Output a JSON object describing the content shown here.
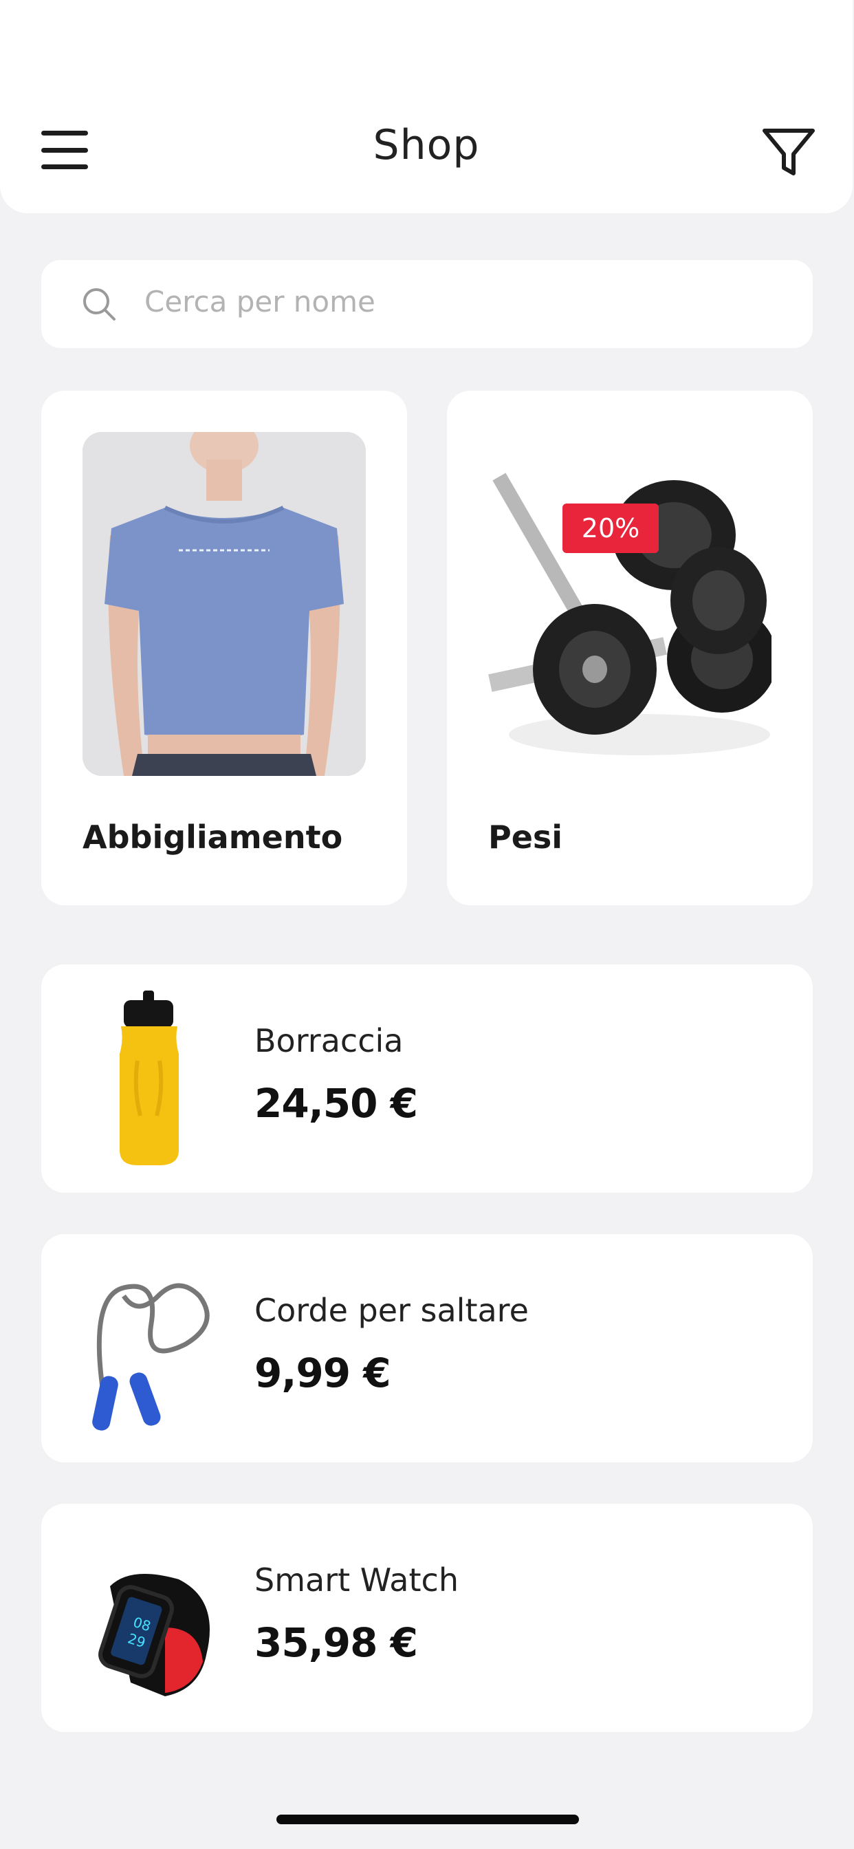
{
  "header": {
    "title": "Shop",
    "menu_icon": "hamburger-menu-icon",
    "filter_icon": "filter-funnel-icon"
  },
  "search": {
    "placeholder": "Cerca per nome",
    "icon": "search-icon"
  },
  "categories": [
    {
      "label": "Abbigliamento",
      "image": "blue-tshirt-photo"
    },
    {
      "label": "Pesi",
      "image": "dumbbells-photo",
      "badge": "20%"
    }
  ],
  "products": [
    {
      "name": "Borraccia",
      "price": "24,50 €",
      "image": "yellow-water-bottle"
    },
    {
      "name": "Corde per saltare",
      "price": "9,99 €",
      "image": "jump-rope"
    },
    {
      "name": "Smart Watch",
      "price": "35,98 €",
      "image": "smart-watch"
    }
  ],
  "colors": {
    "accent_badge": "#e8253a",
    "background": "#f2f2f4",
    "card": "#ffffff",
    "shirt": "#7b93c9"
  }
}
